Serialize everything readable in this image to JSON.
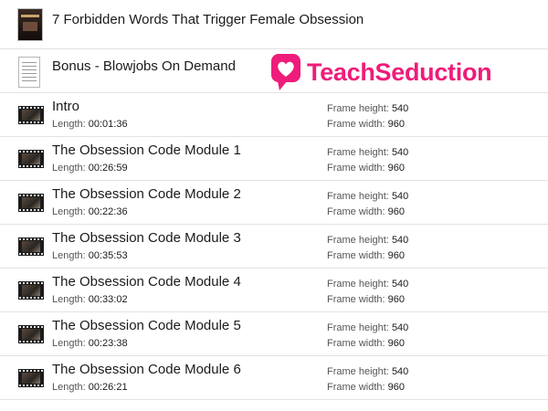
{
  "files": {
    "ebook": {
      "name": "7 Forbidden Words That Trigger Female Obsession"
    },
    "bonus": {
      "name": "Bonus - Blowjobs On Demand"
    },
    "videos": [
      {
        "name": "Intro",
        "length": "00:01:36",
        "frame_height": "540",
        "frame_width": "960"
      },
      {
        "name": "The Obsession Code Module 1",
        "length": "00:26:59",
        "frame_height": "540",
        "frame_width": "960"
      },
      {
        "name": "The Obsession Code Module 2",
        "length": "00:22:36",
        "frame_height": "540",
        "frame_width": "960"
      },
      {
        "name": "The Obsession Code Module 3",
        "length": "00:35:53",
        "frame_height": "540",
        "frame_width": "960"
      },
      {
        "name": "The Obsession Code Module 4",
        "length": "00:33:02",
        "frame_height": "540",
        "frame_width": "960"
      },
      {
        "name": "The Obsession Code Module 5",
        "length": "00:23:38",
        "frame_height": "540",
        "frame_width": "960"
      },
      {
        "name": "The Obsession Code Module 6",
        "length": "00:26:21",
        "frame_height": "540",
        "frame_width": "960"
      }
    ]
  },
  "labels": {
    "length": "Length:",
    "frame_height": "Frame height:",
    "frame_width": "Frame width:"
  },
  "watermark": {
    "text": "TeachSeduction",
    "color": "#ee1c7a",
    "icon": "heart-speech-bubble-icon"
  }
}
